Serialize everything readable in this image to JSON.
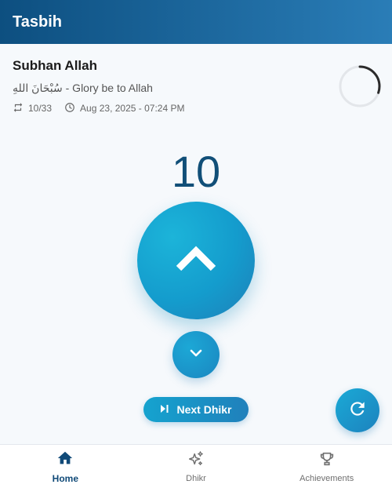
{
  "app": {
    "title": "Tasbih"
  },
  "dhikr": {
    "name": "Subhan Allah",
    "subtitle": "سُبْحَانَ اللهِ - Glory be to Allah",
    "progress_text": "10/33",
    "progress_fraction": 0.303,
    "timestamp": "Aug 23, 2025 - 07:24 PM"
  },
  "counter": {
    "value": "10"
  },
  "actions": {
    "next_label": "Next Dhikr"
  },
  "nav": {
    "items": [
      {
        "label": "Home",
        "icon": "home-icon",
        "active": true
      },
      {
        "label": "Dhikr",
        "icon": "sparkle-icon",
        "active": false
      },
      {
        "label": "Achievements",
        "icon": "trophy-icon",
        "active": false
      }
    ]
  },
  "colors": {
    "primary_dark": "#104a78",
    "accent": "#1aa6d4",
    "header_start": "#0d4f80",
    "header_end": "#2a7db7"
  }
}
